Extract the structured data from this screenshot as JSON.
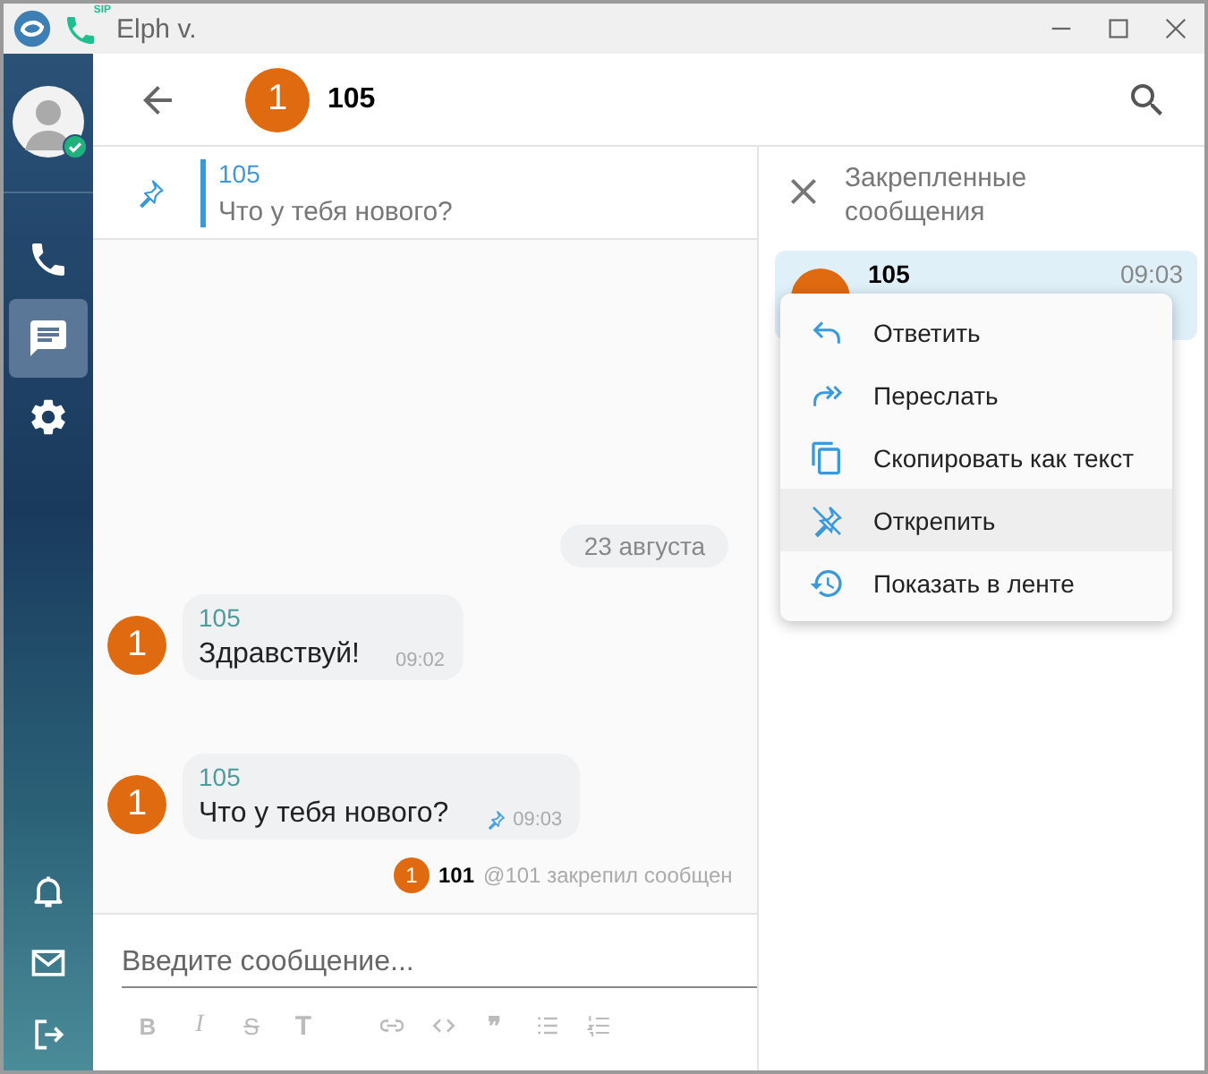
{
  "window": {
    "title": "Elph v.",
    "sip_badge": "SIP"
  },
  "user": {
    "online": true
  },
  "sidebar": {
    "top_items": [
      {
        "kind": "phone",
        "selected": false
      },
      {
        "kind": "chat",
        "selected": true
      },
      {
        "kind": "settings",
        "selected": false
      }
    ],
    "bottom_items": [
      {
        "kind": "bell"
      },
      {
        "kind": "mail"
      },
      {
        "kind": "logout"
      }
    ]
  },
  "chat_header": {
    "avatar": "1",
    "name": "105"
  },
  "pinned_bar": {
    "author": "105",
    "text": "Что у тебя нового?"
  },
  "messages": [
    {
      "kind": "date",
      "text": "23 августа"
    },
    {
      "kind": "message",
      "avatar": "1",
      "author": "105",
      "text": "Здравствуй!",
      "time": "09:02",
      "pinned": false
    },
    {
      "kind": "message",
      "avatar": "1",
      "author": "105",
      "text": "Что у тебя нового?",
      "time": "09:03",
      "pinned": true
    },
    {
      "kind": "event",
      "avatar": "1",
      "author": "101",
      "text": "@101 закрепил сообщен"
    }
  ],
  "composer": {
    "placeholder": "Введите сообщение...",
    "tools": [
      {
        "kind": "bold",
        "label": "B"
      },
      {
        "kind": "italic",
        "label": "I"
      },
      {
        "kind": "strike",
        "label": "S"
      },
      {
        "kind": "heading",
        "label": "T"
      },
      {
        "kind": "link"
      },
      {
        "kind": "code"
      },
      {
        "kind": "quote",
        "label": "❞"
      },
      {
        "kind": "bullets"
      },
      {
        "kind": "numbered"
      }
    ]
  },
  "pinned_panel": {
    "title": "Закрепленные сообщения",
    "items": [
      {
        "author": "105",
        "time": "09:03"
      }
    ]
  },
  "context_menu": {
    "items": [
      {
        "kind": "reply",
        "label": "Ответить",
        "highlighted": false
      },
      {
        "kind": "forward",
        "label": "Переслать",
        "highlighted": false
      },
      {
        "kind": "copy",
        "label": "Скопировать как текст",
        "highlighted": false
      },
      {
        "kind": "unpin",
        "label": "Открепить",
        "highlighted": true
      },
      {
        "kind": "history",
        "label": "Показать в ленте",
        "highlighted": false
      }
    ]
  }
}
